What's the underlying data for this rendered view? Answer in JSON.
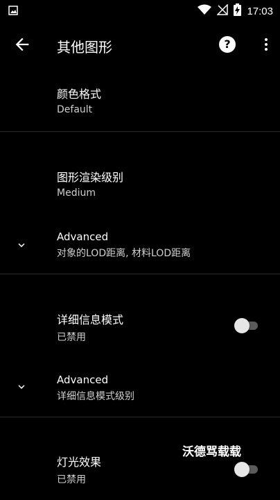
{
  "statusbar": {
    "time": "17:03"
  },
  "appbar": {
    "title": "其他图形"
  },
  "items": [
    {
      "title": "颜色格式",
      "subtitle": "Default"
    },
    {
      "title": "图形渲染级别",
      "subtitle": "Medium"
    },
    {
      "title": "Advanced",
      "subtitle": "对象的LOD距离, 材料LOD距离"
    },
    {
      "title": "详细信息模式",
      "subtitle": "已禁用",
      "switch_on": false
    },
    {
      "title": "Advanced",
      "subtitle": "详细信息模式级别"
    },
    {
      "title": "灯光效果",
      "subtitle": "已禁用",
      "switch_on": false
    }
  ],
  "watermark": "沃德骂载载"
}
